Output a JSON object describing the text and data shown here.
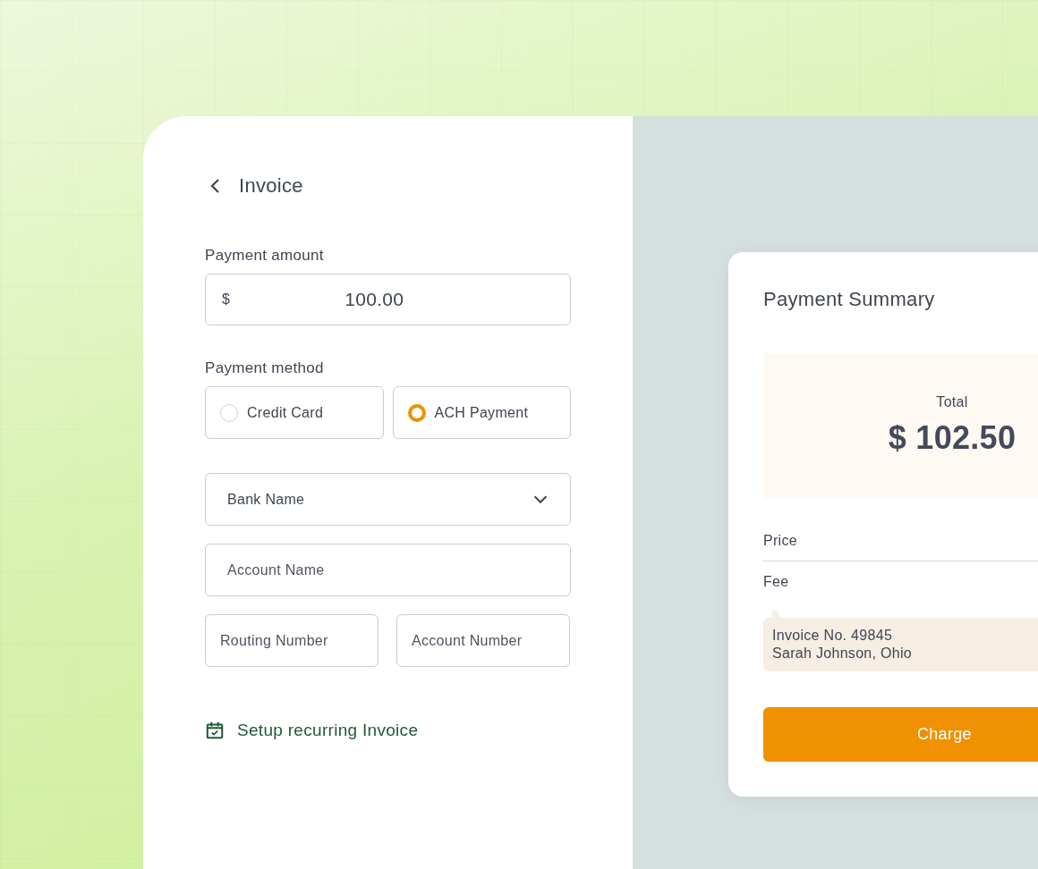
{
  "header": {
    "title": "Invoice"
  },
  "amount": {
    "label": "Payment amount",
    "currency": "$",
    "value": "100.00"
  },
  "payment_method": {
    "label": "Payment method",
    "options": [
      {
        "label": "Credit Card",
        "selected": false
      },
      {
        "label": "ACH Payment",
        "selected": true
      }
    ]
  },
  "fields": [
    {
      "kind": "dropdown",
      "placeholder": "Bank Name"
    },
    {
      "kind": "input",
      "placeholder": "Account Name"
    },
    {
      "kind": "input",
      "placeholder": "Routing Number"
    },
    {
      "kind": "input",
      "placeholder": "Account Number"
    }
  ],
  "recurring_link": "Setup recurring Invoice",
  "summary": {
    "title": "Payment Summary",
    "total_label": "Total",
    "total_value": "$ 102.50",
    "rows": [
      "Price",
      "Fee"
    ],
    "note": [
      "Invoice No. 49845",
      "Sarah Johnson, Ohio"
    ],
    "button": "Charge"
  }
}
